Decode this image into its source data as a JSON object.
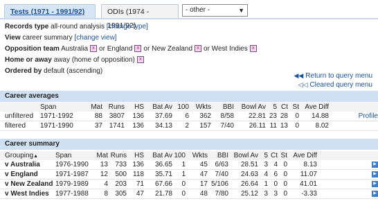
{
  "tabs": {
    "active": "Tests (1971 - 1991/92)",
    "inactive": "ODIs (1974 - 1991/92)",
    "other_select": "- other -"
  },
  "query": {
    "records_type_label": "Records type",
    "records_type_value": "all-round analysis",
    "change_type": "[change type]",
    "view_label": "View",
    "view_value": "career summary",
    "change_view": "[change view]",
    "opposition_label": "Opposition team",
    "opp_1": "Australia",
    "opp_or_1": "or England",
    "opp_or_2": "or New Zealand",
    "opp_or_3": "or West Indies",
    "home_away_label": "Home or away",
    "home_away_value": "away (home of opposition)",
    "ordered_label": "Ordered by",
    "ordered_value": "default (ascending)"
  },
  "links": {
    "return_query_menu": "Return to query menu",
    "cleared_query_menu": "Cleared query menu"
  },
  "career_averages": {
    "title": "Career averages",
    "headers": [
      "",
      "Span",
      "Mat",
      "Runs",
      "HS",
      "Bat Av",
      "100",
      "Wkts",
      "BBI",
      "Bowl Av",
      "5",
      "Ct",
      "St",
      "Ave Diff",
      ""
    ],
    "rows": [
      [
        "unfiltered",
        "1971-1992",
        "88",
        "3807",
        "136",
        "37.69",
        "6",
        "362",
        "8/58",
        "22.81",
        "23",
        "28",
        "0",
        "14.88",
        "Profile"
      ],
      [
        "filtered",
        "1971-1990",
        "37",
        "1741",
        "136",
        "34.13",
        "2",
        "157",
        "7/40",
        "26.11",
        "11",
        "13",
        "0",
        "8.02",
        ""
      ]
    ]
  },
  "career_summary": {
    "title": "Career summary",
    "headers": [
      "Grouping",
      "Span",
      "Mat",
      "Runs",
      "HS",
      "Bat Av",
      "100",
      "Wkts",
      "BBI",
      "Bowl Av",
      "5",
      "Ct",
      "St",
      "Ave Diff",
      ""
    ],
    "rows": [
      [
        "v Australia",
        "1976-1990",
        "13",
        "733",
        "136",
        "36.65",
        "1",
        "45",
        "6/63",
        "28.51",
        "3",
        "4",
        "0",
        "8.13"
      ],
      [
        "v England",
        "1971-1987",
        "12",
        "500",
        "118",
        "35.71",
        "1",
        "47",
        "7/40",
        "24.63",
        "4",
        "6",
        "0",
        "11.07"
      ],
      [
        "v New Zealand",
        "1979-1989",
        "4",
        "203",
        "71",
        "67.66",
        "0",
        "17",
        "5/106",
        "26.64",
        "1",
        "0",
        "0",
        "41.01"
      ],
      [
        "v West Indies",
        "1977-1988",
        "8",
        "305",
        "47",
        "21.78",
        "0",
        "48",
        "7/80",
        "25.12",
        "3",
        "3",
        "0",
        "-3.33"
      ]
    ]
  },
  "icons": {
    "remove": "x-remove-icon",
    "play": "play-arrow-icon",
    "return": "double-left-arrow-icon",
    "sort": "sort-ascending-icon"
  },
  "colors": {
    "link": "#1a4f9c",
    "section_bg": "#cfe0f3",
    "tab_active_bg": "#d7e6f7",
    "play_icon": "#3a7fcf"
  }
}
